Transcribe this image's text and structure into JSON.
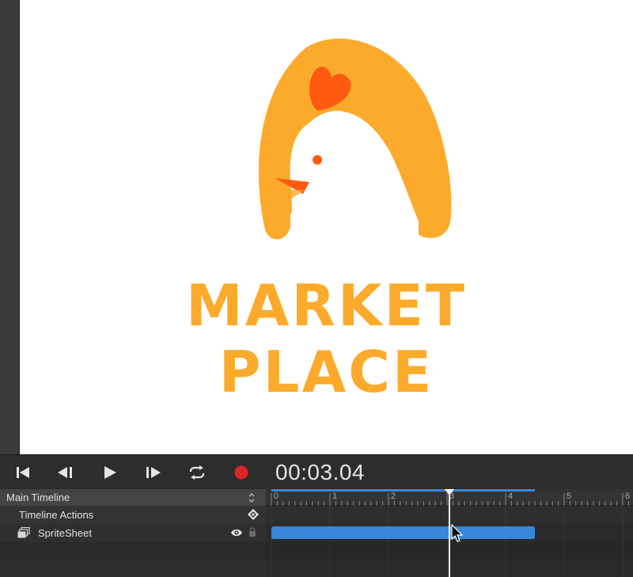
{
  "stage": {
    "logo": {
      "line1": "MARKET",
      "line2": "PLACE",
      "primary_color": "#FCAA2B",
      "accent_color": "#FF5A0F"
    }
  },
  "transport": {
    "buttons": [
      "skip-to-start-icon",
      "step-back-icon",
      "play-icon",
      "step-forward-icon",
      "loop-icon",
      "record-icon"
    ],
    "time": "00:03.04",
    "record_color": "#E0222B"
  },
  "timeline": {
    "selector_label": "Main Timeline",
    "layers": [
      {
        "name": "Timeline Actions",
        "icon": "diamond-move-icon"
      },
      {
        "name": "SpriteSheet",
        "icon": "spritesheet-icon",
        "visible": true,
        "locked": false
      }
    ],
    "ruler_labels": [
      "0",
      "1",
      "2",
      "3",
      "4",
      "5",
      "6"
    ],
    "playhead_seconds": 3.04,
    "clip": {
      "layer": "SpriteSheet",
      "start": 0,
      "end": 4.5,
      "color": "#3C86D9"
    },
    "accent_color": "#3D86D8"
  }
}
